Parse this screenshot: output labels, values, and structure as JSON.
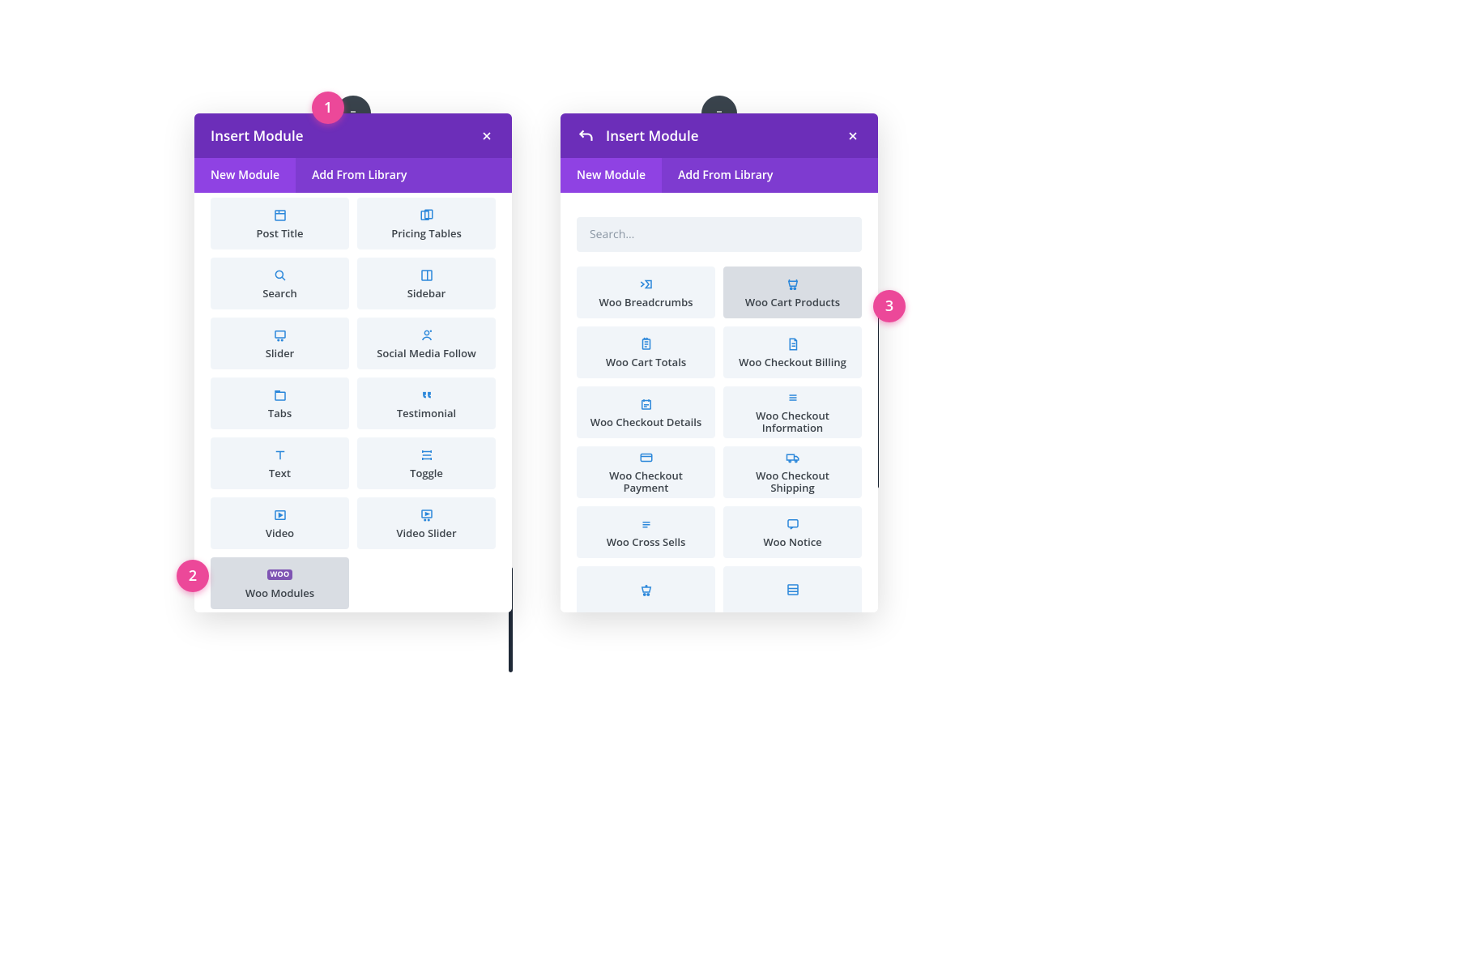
{
  "annotations": {
    "a1": "1",
    "a2": "2",
    "a3": "3"
  },
  "panel1": {
    "header": {
      "title": "Insert Module"
    },
    "tabs": {
      "new": "New Module",
      "library": "Add From Library"
    },
    "modules": [
      {
        "label": "Post Title",
        "icon": "post-title"
      },
      {
        "label": "Pricing Tables",
        "icon": "pricing"
      },
      {
        "label": "Search",
        "icon": "search"
      },
      {
        "label": "Sidebar",
        "icon": "sidebar"
      },
      {
        "label": "Slider",
        "icon": "slider"
      },
      {
        "label": "Social Media Follow",
        "icon": "social"
      },
      {
        "label": "Tabs",
        "icon": "tabs"
      },
      {
        "label": "Testimonial",
        "icon": "quote"
      },
      {
        "label": "Text",
        "icon": "text"
      },
      {
        "label": "Toggle",
        "icon": "toggle"
      },
      {
        "label": "Video",
        "icon": "video"
      },
      {
        "label": "Video Slider",
        "icon": "video-slider"
      },
      {
        "label": "Woo Modules",
        "icon": "woo",
        "hover": true
      }
    ]
  },
  "panel2": {
    "header": {
      "title": "Insert Module"
    },
    "tabs": {
      "new": "New Module",
      "library": "Add From Library"
    },
    "search_placeholder": "Search...",
    "modules": [
      {
        "label": "Woo Breadcrumbs",
        "icon": "breadcrumb"
      },
      {
        "label": "Woo Cart Products",
        "icon": "cart",
        "hover": true
      },
      {
        "label": "Woo Cart Totals",
        "icon": "receipt"
      },
      {
        "label": "Woo Checkout Billing",
        "icon": "file"
      },
      {
        "label": "Woo Checkout Details",
        "icon": "details"
      },
      {
        "label": "Woo Checkout Information",
        "icon": "lines"
      },
      {
        "label": "Woo Checkout Payment",
        "icon": "card"
      },
      {
        "label": "Woo Checkout Shipping",
        "icon": "truck"
      },
      {
        "label": "Woo Cross Sells",
        "icon": "lines"
      },
      {
        "label": "Woo Notice",
        "icon": "notice"
      },
      {
        "label": "",
        "icon": "cart-plus"
      },
      {
        "label": "",
        "icon": "grid"
      }
    ]
  }
}
